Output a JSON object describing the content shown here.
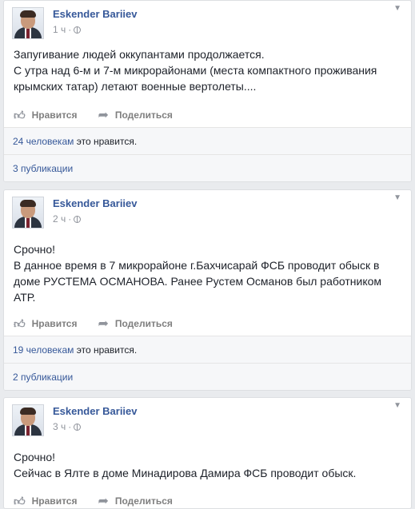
{
  "posts": [
    {
      "author": "Eskender Bariiev",
      "time": "1 ч",
      "text": "Запугивание людей оккупантами продолжается.\nС утра над 6-м и 7-м микрорайонами (места компактного проживания крымских татар) летают военные вертолеты....",
      "like_label": "Нравится",
      "share_label": "Поделиться",
      "likes_link": "24 человекам",
      "likes_suffix": "это нравится.",
      "shares": "3 публикации"
    },
    {
      "author": "Eskender Bariiev",
      "time": "2 ч",
      "text": "Срочно!\nВ данное время в 7 микрорайоне г.Бахчисарай ФСБ проводит обыск в доме РУСТЕМА ОСМАНОВА. Ранее Рустем Османов был работником АТР.",
      "like_label": "Нравится",
      "share_label": "Поделиться",
      "likes_link": "19 человекам",
      "likes_suffix": "это нравится.",
      "shares": "2 публикации"
    },
    {
      "author": "Eskender Bariiev",
      "time": "3 ч",
      "text": "Срочно!\nСейчас в Ялте в доме Минадирова Дамира ФСБ проводит обыск.",
      "like_label": "Нравится",
      "share_label": "Поделиться"
    }
  ],
  "colors": {
    "page_bg": "#e9ebee",
    "link": "#365899",
    "meta": "#90949c"
  },
  "icons": {
    "like": "thumbs-up-icon",
    "share": "share-arrow-icon",
    "privacy": "globe-icon",
    "menu": "chevron-down-icon"
  }
}
